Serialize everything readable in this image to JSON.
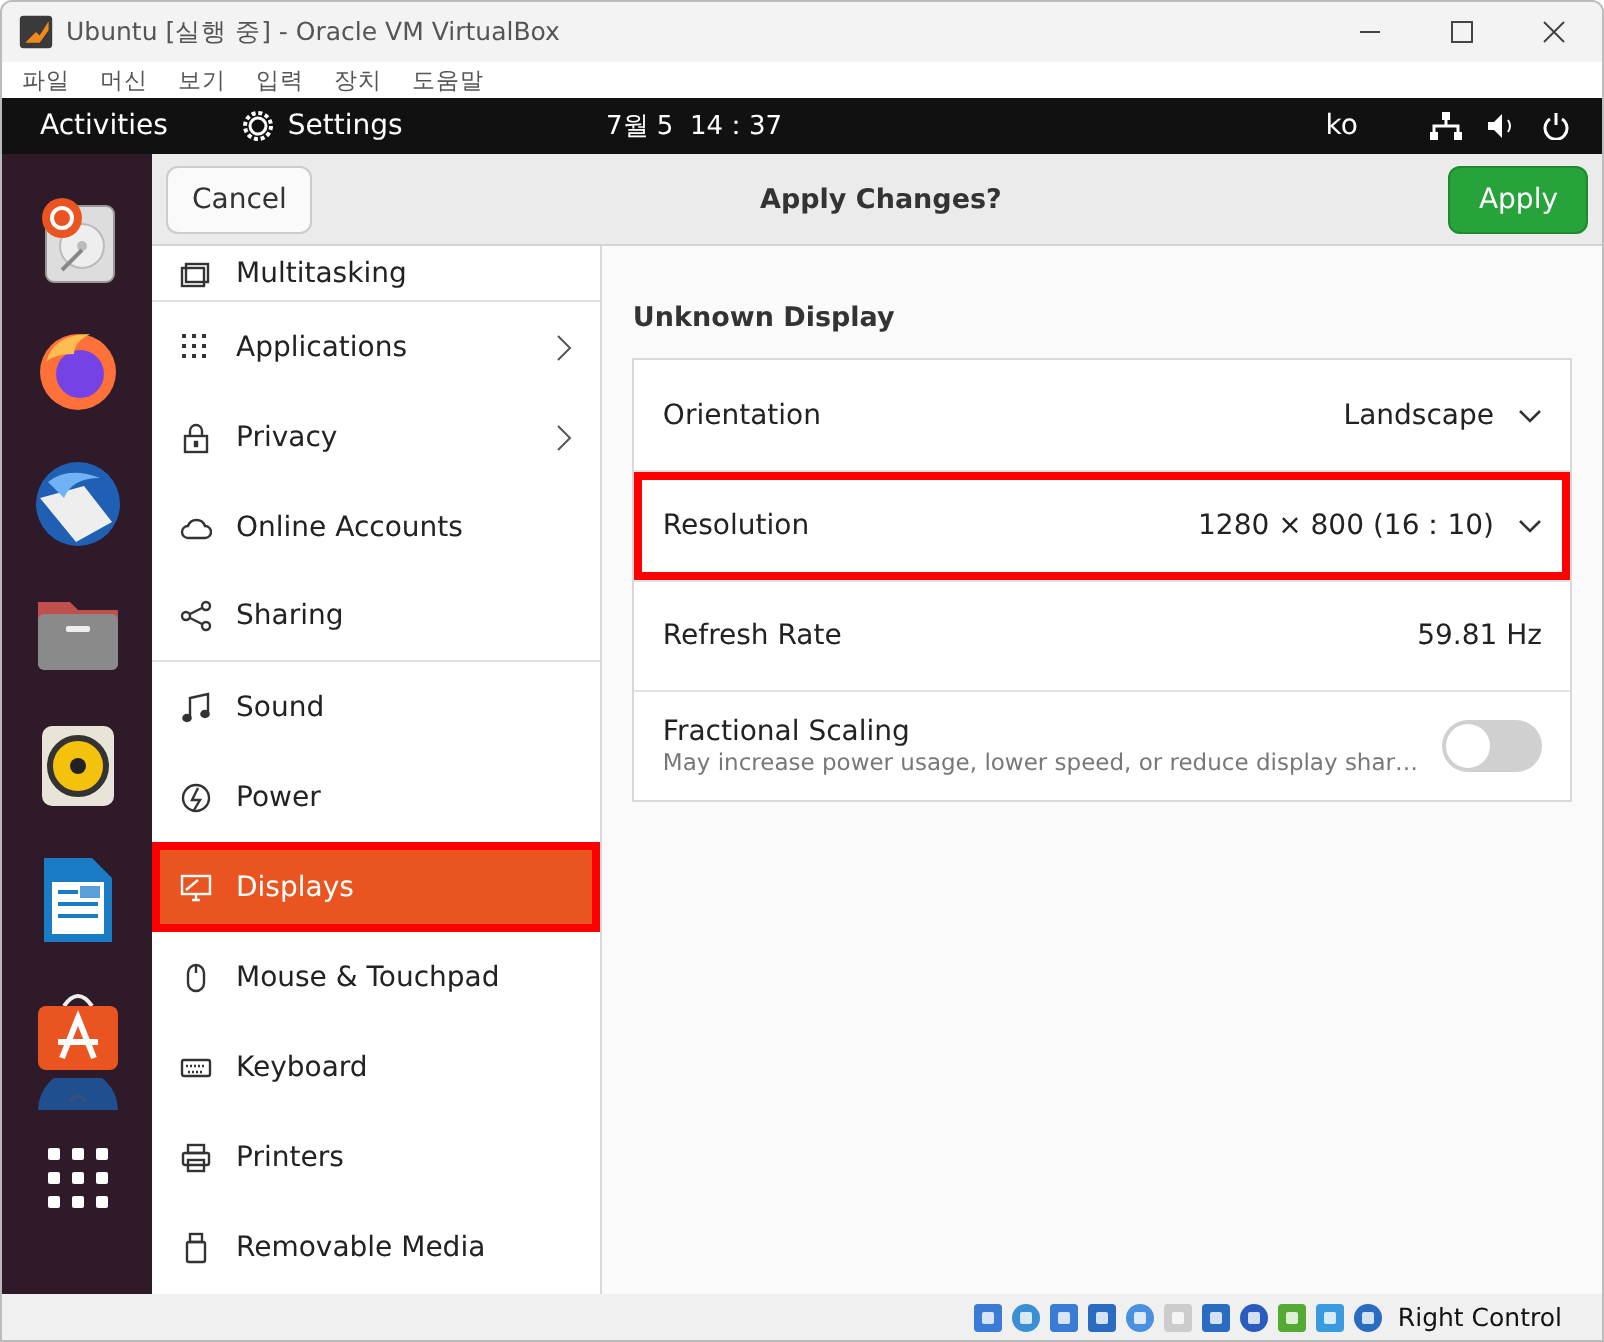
{
  "window": {
    "title": "Ubuntu [실행 중] - Oracle VM VirtualBox"
  },
  "menu_bar": [
    "파일",
    "머신",
    "보기",
    "입력",
    "장치",
    "도움말"
  ],
  "top_bar": {
    "activities": "Activities",
    "app": "Settings",
    "clock": "7월 5  14：37",
    "language": "ko"
  },
  "header_bar": {
    "cancel": "Cancel",
    "title": "Apply Changes?",
    "apply": "Apply"
  },
  "sidebar": {
    "items": [
      {
        "label": "Multitasking",
        "kind": "multitasking",
        "selected": false,
        "highlighted": false,
        "arrow": false,
        "divider_after": true
      },
      {
        "label": "Applications",
        "kind": "applications",
        "selected": false,
        "highlighted": false,
        "arrow": true,
        "divider_after": false
      },
      {
        "label": "Privacy",
        "kind": "privacy",
        "selected": false,
        "highlighted": false,
        "arrow": true,
        "divider_after": false
      },
      {
        "label": "Online Accounts",
        "kind": "online",
        "selected": false,
        "highlighted": false,
        "arrow": false,
        "divider_after": false
      },
      {
        "label": "Sharing",
        "kind": "sharing",
        "selected": false,
        "highlighted": false,
        "arrow": false,
        "divider_after": true
      },
      {
        "label": "Sound",
        "kind": "sound",
        "selected": false,
        "highlighted": false,
        "arrow": false,
        "divider_after": false
      },
      {
        "label": "Power",
        "kind": "power",
        "selected": false,
        "highlighted": false,
        "arrow": false,
        "divider_after": false
      },
      {
        "label": "Displays",
        "kind": "displays",
        "selected": true,
        "highlighted": true,
        "arrow": false,
        "divider_after": false
      },
      {
        "label": "Mouse & Touchpad",
        "kind": "mouse",
        "selected": false,
        "highlighted": false,
        "arrow": false,
        "divider_after": false
      },
      {
        "label": "Keyboard",
        "kind": "keyboard",
        "selected": false,
        "highlighted": false,
        "arrow": false,
        "divider_after": false
      },
      {
        "label": "Printers",
        "kind": "printers",
        "selected": false,
        "highlighted": false,
        "arrow": false,
        "divider_after": false
      },
      {
        "label": "Removable Media",
        "kind": "removable",
        "selected": false,
        "highlighted": false,
        "arrow": false,
        "divider_after": false
      }
    ]
  },
  "display": {
    "title": "Unknown Display",
    "rows": [
      {
        "kind": "dropdown",
        "label": "Orientation",
        "value": "Landscape",
        "highlighted": false
      },
      {
        "kind": "dropdown",
        "label": "Resolution",
        "value": "1280 × 800 (16：10)",
        "highlighted": true
      },
      {
        "kind": "value",
        "label": "Refresh Rate",
        "value": "59.81 Hz",
        "highlighted": false
      },
      {
        "kind": "toggle",
        "label": "Fractional Scaling",
        "description": "May increase power usage, lower speed, or reduce display shar…",
        "on": false,
        "highlighted": false
      }
    ]
  },
  "status_bar": {
    "host_key": "Right Control"
  }
}
